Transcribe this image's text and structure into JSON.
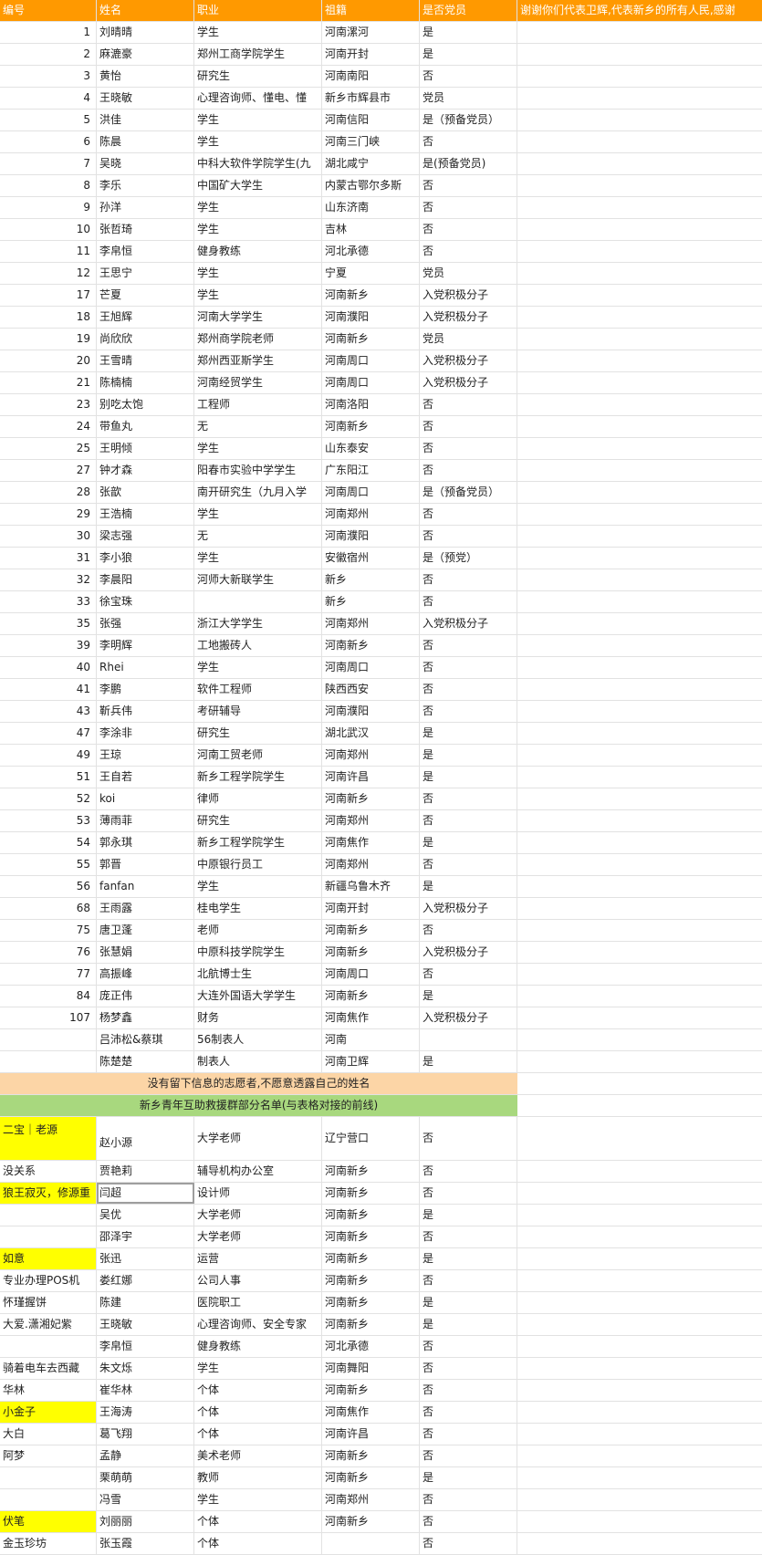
{
  "header": [
    "编号",
    "姓名",
    "职业",
    "祖籍",
    "是否党员",
    "谢谢你们代表卫辉,代表新乡的所有人民,感谢"
  ],
  "rows": [
    [
      "1",
      "刘晴晴",
      "学生",
      "河南漯河",
      "是"
    ],
    [
      "2",
      "麻漉豪",
      "郑州工商学院学生",
      "河南开封",
      "是"
    ],
    [
      "3",
      "黄怡",
      "研究生",
      "河南南阳",
      "否"
    ],
    [
      "4",
      "王晓敏",
      "心理咨询师、懂电、懂",
      "新乡市辉县市",
      "党员"
    ],
    [
      "5",
      "洪佳",
      "学生",
      "河南信阳",
      "是（预备党员）"
    ],
    [
      "6",
      "陈晨",
      "学生",
      "河南三门峡",
      "否"
    ],
    [
      "7",
      "吴晓",
      "中科大软件学院学生(九",
      "湖北咸宁",
      "是(预备党员)"
    ],
    [
      "8",
      "李乐",
      "中国矿大学生",
      "内蒙古鄂尔多斯",
      "否"
    ],
    [
      "9",
      "孙洋",
      "学生",
      "山东济南",
      "否"
    ],
    [
      "10",
      "张哲琦",
      "学生",
      "吉林",
      "否"
    ],
    [
      "11",
      "李帛恒",
      "健身教练",
      "河北承德",
      "否"
    ],
    [
      "12",
      "王思宁",
      "学生",
      "宁夏",
      "党员"
    ],
    [
      "17",
      "芒夏",
      "学生",
      "河南新乡",
      "入党积极分子"
    ],
    [
      "18",
      "王旭辉",
      "河南大学学生",
      "河南濮阳",
      "入党积极分子"
    ],
    [
      "19",
      "尚欣欣",
      "郑州商学院老师",
      "河南新乡",
      "党员"
    ],
    [
      "20",
      "王雪晴",
      "郑州西亚斯学生",
      "河南周口",
      "入党积极分子"
    ],
    [
      "21",
      "陈楠楠",
      "河南经贸学生",
      "河南周口",
      "入党积极分子"
    ],
    [
      "23",
      "别吃太饱",
      "工程师",
      "河南洛阳",
      "否"
    ],
    [
      "24",
      "带鱼丸",
      "无",
      "河南新乡",
      "否"
    ],
    [
      "25",
      "王明倾",
      "学生",
      "山东泰安",
      "否"
    ],
    [
      "27",
      "钟才森",
      "阳春市实验中学学生",
      "广东阳江",
      "否"
    ],
    [
      "28",
      "张歆",
      "南开研究生（九月入学",
      "河南周口",
      "是（预备党员）"
    ],
    [
      "29",
      "王浩楠",
      "学生",
      "河南郑州",
      "否"
    ],
    [
      "30",
      "梁志强",
      "无",
      "河南濮阳",
      "否"
    ],
    [
      "31",
      "李小狼",
      "学生",
      "安徽宿州",
      "是（预党）"
    ],
    [
      "32",
      "李晨阳",
      "河师大新联学生",
      "新乡",
      "否"
    ],
    [
      "33",
      "徐宝珠",
      "",
      "新乡",
      "否"
    ],
    [
      "35",
      "张强",
      "浙江大学学生",
      "河南郑州",
      "入党积极分子"
    ],
    [
      "39",
      "李明辉",
      "工地搬砖人",
      "河南新乡",
      "否"
    ],
    [
      "40",
      "Rhei",
      "学生",
      "河南周口",
      "否"
    ],
    [
      "41",
      "李鹏",
      " 软件工程师",
      "陕西西安",
      "否"
    ],
    [
      "43",
      "靳兵伟",
      "考研辅导",
      "河南濮阳",
      "否"
    ],
    [
      "47",
      "李涂非",
      "研究生",
      "湖北武汉",
      "是"
    ],
    [
      "49",
      "王琼",
      "河南工贸老师",
      "河南郑州",
      "是"
    ],
    [
      "51",
      "王自若",
      "新乡工程学院学生",
      "河南许昌",
      "是"
    ],
    [
      "52",
      "koi",
      "律师",
      "河南新乡",
      "否"
    ],
    [
      "53",
      "薄雨菲",
      "研究生",
      "河南郑州",
      "否"
    ],
    [
      "54",
      "郭永琪",
      "新乡工程学院学生",
      "河南焦作",
      "是"
    ],
    [
      "55",
      "郭晋",
      "中原银行员工",
      "河南郑州",
      "否"
    ],
    [
      "56",
      "fanfan",
      "学生",
      "新疆乌鲁木齐",
      "是"
    ],
    [
      "68",
      "王雨露",
      "桂电学生",
      "河南开封",
      "入党积极分子"
    ],
    [
      "75",
      "唐卫蓬",
      "老师",
      "河南新乡",
      "否"
    ],
    [
      "76",
      "张慧娟",
      "中原科技学院学生",
      "河南新乡",
      "入党积极分子"
    ],
    [
      "77",
      "高振峰",
      "北航博士生",
      "河南周口",
      "否"
    ],
    [
      "84",
      "庞正伟",
      "大连外国语大学学生",
      "河南新乡",
      "是"
    ],
    [
      "107",
      "杨梦鑫",
      "财务",
      "河南焦作",
      "入党积极分子"
    ],
    [
      "",
      "吕沛松&蔡琪",
      "56制表人",
      "河南",
      ""
    ],
    [
      "",
      "陈楚楚",
      "制表人",
      "河南卫辉",
      "是"
    ]
  ],
  "banner_anonymous": "没有留下信息的志愿者,不愿意透露自己的姓名",
  "banner_group": "新乡青年互助救援群部分名单(与表格对接的前线)",
  "group_rows": [
    [
      "二宝｜老源",
      "赵小源",
      "大学老师",
      "辽宁营口",
      "否"
    ],
    [
      "没关系",
      "贾艳莉",
      "辅导机构办公室",
      "河南新乡",
      "否"
    ],
    [
      "狼王寂灭，修源重",
      "闫超",
      "设计师",
      "河南新乡",
      "否"
    ],
    [
      "",
      "吴优",
      "大学老师",
      "河南新乡",
      "是"
    ],
    [
      "",
      "邵泽宇",
      "大学老师",
      "河南新乡",
      "否"
    ],
    [
      "如意",
      "张迅",
      "运营",
      "河南新乡",
      "是"
    ],
    [
      "专业办理POS机",
      "娄红娜",
      "公司人事",
      "河南新乡",
      "否"
    ],
    [
      "怀瑾握饼",
      "陈建",
      "医院职工",
      "河南新乡",
      "是"
    ],
    [
      "大爱.潇湘妃紫",
      "王晓敏",
      "心理咨询师、安全专家",
      "河南新乡",
      "是"
    ],
    [
      "",
      "李帛恒",
      "健身教练",
      "河北承德",
      "否"
    ],
    [
      "骑着电车去西藏",
      "朱文烁",
      "学生",
      "河南舞阳",
      "否"
    ],
    [
      "华林",
      "崔华林",
      "个体",
      "河南新乡",
      "否"
    ],
    [
      "小金子",
      "王海涛",
      "个体",
      "河南焦作",
      "否"
    ],
    [
      "大白",
      "葛飞翔",
      "个体",
      "河南许昌",
      "否"
    ],
    [
      "阿梦",
      "孟静",
      "美术老师",
      "河南新乡",
      "否"
    ],
    [
      "",
      "栗萌萌",
      "教师",
      "河南新乡",
      "是"
    ],
    [
      "",
      "冯雪",
      "学生",
      "河南郑州",
      "否"
    ],
    [
      "伏笔",
      "刘丽丽",
      "个体",
      "河南新乡",
      "否"
    ],
    [
      "金玉珍坊",
      "张玉霞",
      "个体",
      "",
      "否"
    ]
  ],
  "highlight_color": "#ffff00",
  "header_color": "#ff9900"
}
